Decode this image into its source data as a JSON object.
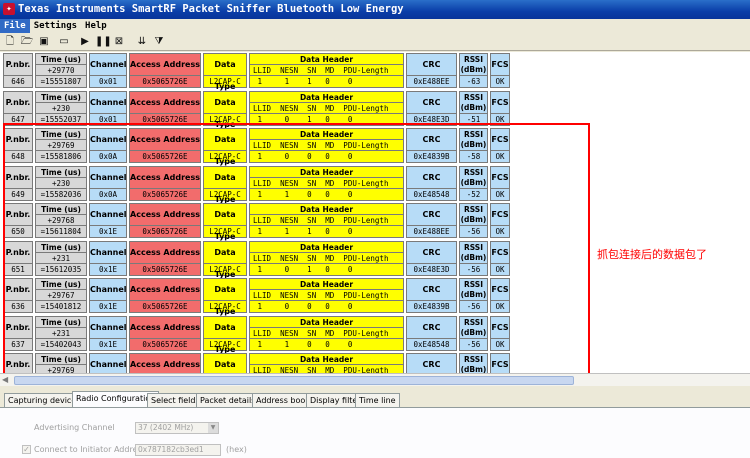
{
  "window": {
    "title": "Texas Instruments SmartRF Packet Sniffer Bluetooth Low Energy"
  },
  "menu": [
    "File",
    "Settings",
    "Help"
  ],
  "toolbar_icons": [
    "new-icon",
    "open-icon",
    "save-icon",
    "folder-icon",
    "play-icon",
    "pause-icon",
    "clear-icon",
    "scroll-down-icon",
    "filter-icon"
  ],
  "columns": {
    "pnbr": "P.nbr.",
    "time": "Time (us)",
    "channel": "Channel",
    "access_address": "Access Address",
    "data_type": "Data Type",
    "data_header": "Data Header",
    "data_header_fields": "LLID  NESN  SN  MD  PDU-Length",
    "crc": "CRC",
    "rssi": "RSSI\n(dBm)",
    "rssi_line1": "RSSI",
    "rssi_line2": "(dBm)",
    "fcs": "FCS"
  },
  "packets": [
    {
      "pnbr": "646",
      "delta": "+29770",
      "time": "=15551807",
      "channel": "0x01",
      "aa": "0x5065726E",
      "type": "L2CAP-C",
      "hdr": " 1     1    1   0    0",
      "crc": "0xE488EE",
      "rssi": "-63",
      "fcs": "OK"
    },
    {
      "pnbr": "647",
      "delta": "+230",
      "time": "=15552037",
      "channel": "0x01",
      "aa": "0x5065726E",
      "type": "L2CAP-C",
      "hdr": " 1     0    1   0    0",
      "crc": "0xE48E3D",
      "rssi": "-51",
      "fcs": "OK"
    },
    {
      "pnbr": "648",
      "delta": "+29769",
      "time": "=15581806",
      "channel": "0x0A",
      "aa": "0x5065726E",
      "type": "L2CAP-C",
      "hdr": " 1     0    0   0    0",
      "crc": "0xE4839B",
      "rssi": "-58",
      "fcs": "OK"
    },
    {
      "pnbr": "649",
      "delta": "+230",
      "time": "=15582036",
      "channel": "0x0A",
      "aa": "0x5065726E",
      "type": "L2CAP-C",
      "hdr": " 1     1    0   0    0",
      "crc": "0xE48548",
      "rssi": "-52",
      "fcs": "OK"
    },
    {
      "pnbr": "650",
      "delta": "+29768",
      "time": "=15611804",
      "channel": "0x1E",
      "aa": "0x5065726E",
      "type": "L2CAP-C",
      "hdr": " 1     1    1   0    0",
      "crc": "0xE488EE",
      "rssi": "-56",
      "fcs": "OK"
    },
    {
      "pnbr": "651",
      "delta": "+231",
      "time": "=15612035",
      "channel": "0x1E",
      "aa": "0x5065726E",
      "type": "L2CAP-C",
      "hdr": " 1     0    1   0    0",
      "crc": "0xE48E3D",
      "rssi": "-56",
      "fcs": "OK"
    },
    {
      "pnbr": "636",
      "delta": "+29767",
      "time": "=15401812",
      "channel": "0x1E",
      "aa": "0x5065726E",
      "type": "L2CAP-C",
      "hdr": " 1     0    0   0    0",
      "crc": "0xE4839B",
      "rssi": "-56",
      "fcs": "OK"
    },
    {
      "pnbr": "637",
      "delta": "+231",
      "time": "=15402043",
      "channel": "0x1E",
      "aa": "0x5065726E",
      "type": "L2CAP-C",
      "hdr": " 1     1    0   0    0",
      "crc": "0xE48548",
      "rssi": "-56",
      "fcs": "OK"
    },
    {
      "pnbr": "",
      "delta": "+29769",
      "time": "",
      "channel": "",
      "aa": "",
      "type": "",
      "hdr": "",
      "crc": "",
      "rssi": "",
      "fcs": ""
    }
  ],
  "annotation": "抓包连接后的数据包了",
  "tabs": [
    "Capturing device",
    "Radio Configuration",
    "Select fields",
    "Packet details",
    "Address book",
    "Display filter",
    "Time line"
  ],
  "active_tab": "Radio Configuration",
  "radio_config": {
    "adv_channel_label": "Advertising Channel",
    "adv_channel_value": "37 (2402 MHz)",
    "connect_label": "Connect to Initiator Address",
    "connect_value": "0x787182cb3ed1",
    "connect_unit": "(hex)",
    "connect_checked": true
  },
  "colors": {
    "highlight": "#ff0000",
    "access_address": "#f26c6c",
    "data_type": "#ffff00",
    "channel": "#b7dcf7"
  }
}
